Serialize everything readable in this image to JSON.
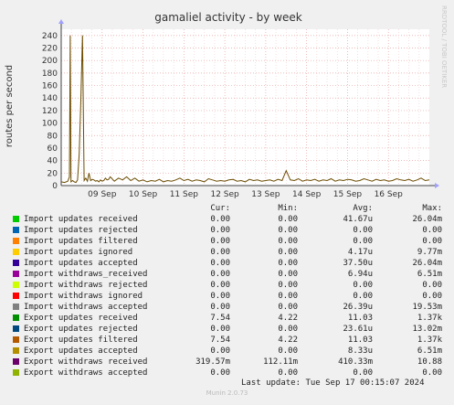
{
  "chart_data": {
    "type": "line",
    "title": "gamaliel activity - by week",
    "ylabel": "routes per second",
    "watermark": "RRDTOOL / TOBI OETIKER",
    "x_ticks": [
      "09 Sep",
      "10 Sep",
      "11 Sep",
      "12 Sep",
      "13 Sep",
      "14 Sep",
      "15 Sep",
      "16 Sep"
    ],
    "y_ticks": [
      0,
      20,
      40,
      60,
      80,
      100,
      120,
      140,
      160,
      180,
      200,
      220,
      240
    ],
    "ylim": [
      0,
      250
    ],
    "x_range_days": [
      "08 Sep 2024 (approx.)",
      "17 Sep 2024"
    ],
    "grid": true,
    "series": [
      {
        "name": "Export withdraws received",
        "color": "#6b4c00",
        "x": [
          0.0,
          0.08,
          0.16,
          0.2,
          0.22,
          0.24,
          0.28,
          0.32,
          0.36,
          0.4,
          0.44,
          0.48,
          0.52,
          0.56,
          0.6,
          0.64,
          0.68,
          0.72,
          0.76,
          0.8,
          0.84,
          0.88,
          0.92,
          0.96,
          1.0,
          1.04,
          1.08,
          1.12,
          1.16,
          1.2,
          1.3,
          1.4,
          1.5,
          1.6,
          1.7,
          1.8,
          1.9,
          2.0,
          2.1,
          2.2,
          2.3,
          2.4,
          2.5,
          2.6,
          2.7,
          2.8,
          2.9,
          3.0,
          3.1,
          3.2,
          3.3,
          3.4,
          3.5,
          3.6,
          3.7,
          3.8,
          3.9,
          4.0,
          4.1,
          4.2,
          4.3,
          4.4,
          4.5,
          4.6,
          4.7,
          4.8,
          4.9,
          5.0,
          5.1,
          5.2,
          5.3,
          5.4,
          5.5,
          5.6,
          5.7,
          5.8,
          5.9,
          6.0,
          6.1,
          6.2,
          6.3,
          6.4,
          6.5,
          6.6,
          6.7,
          6.8,
          6.9,
          7.0,
          7.1,
          7.2,
          7.3,
          7.4,
          7.5,
          7.6,
          7.7,
          7.8,
          7.9,
          8.0,
          8.1,
          8.2,
          8.3,
          8.4,
          8.5,
          8.6,
          8.7,
          8.8,
          8.9,
          9.0
        ],
        "values": [
          6,
          5,
          7,
          14,
          240,
          6,
          8,
          6,
          5,
          9,
          50,
          137,
          240,
          8,
          12,
          7,
          20,
          8,
          10,
          9,
          7,
          8,
          6,
          9,
          7,
          8,
          12,
          9,
          10,
          14,
          7,
          12,
          9,
          14,
          8,
          12,
          7,
          9,
          6,
          8,
          7,
          10,
          6,
          8,
          7,
          9,
          12,
          8,
          10,
          7,
          9,
          8,
          6,
          11,
          9,
          7,
          8,
          7,
          9,
          10,
          7,
          8,
          6,
          10,
          8,
          9,
          7,
          8,
          9,
          7,
          10,
          8,
          24,
          9,
          8,
          11,
          7,
          9,
          8,
          10,
          7,
          9,
          8,
          11,
          7,
          9,
          8,
          10,
          9,
          7,
          8,
          11,
          9,
          7,
          10,
          8,
          9,
          7,
          8,
          11,
          9,
          8,
          10,
          7,
          9,
          12,
          8,
          9
        ]
      }
    ]
  },
  "legend": {
    "headers": [
      "Cur:",
      "Min:",
      "Avg:",
      "Max:"
    ],
    "rows": [
      {
        "name": "Import updates received",
        "color": "#00cc00",
        "cur": "0.00",
        "min": "0.00",
        "avg": "41.67u",
        "max": "26.04m"
      },
      {
        "name": "Import updates rejected",
        "color": "#0066b3",
        "cur": "0.00",
        "min": "0.00",
        "avg": "0.00",
        "max": "0.00"
      },
      {
        "name": "Import updates filtered",
        "color": "#ff8000",
        "cur": "0.00",
        "min": "0.00",
        "avg": "0.00",
        "max": "0.00"
      },
      {
        "name": "Import updates ignored",
        "color": "#ffcc00",
        "cur": "0.00",
        "min": "0.00",
        "avg": "4.17u",
        "max": "9.77m"
      },
      {
        "name": "Import updates accepted",
        "color": "#330099",
        "cur": "0.00",
        "min": "0.00",
        "avg": "37.50u",
        "max": "26.04m"
      },
      {
        "name": "Import withdraws_received",
        "color": "#990099",
        "cur": "0.00",
        "min": "0.00",
        "avg": "6.94u",
        "max": "6.51m"
      },
      {
        "name": "Import withdraws rejected",
        "color": "#ccff00",
        "cur": "0.00",
        "min": "0.00",
        "avg": "0.00",
        "max": "0.00"
      },
      {
        "name": "Import withdraws ignored",
        "color": "#ff0000",
        "cur": "0.00",
        "min": "0.00",
        "avg": "0.00",
        "max": "0.00"
      },
      {
        "name": "Import withdraws accepted",
        "color": "#808080",
        "cur": "0.00",
        "min": "0.00",
        "avg": "26.39u",
        "max": "19.53m"
      },
      {
        "name": "Export updates received",
        "color": "#008f00",
        "cur": "7.54",
        "min": "4.22",
        "avg": "11.03",
        "max": "1.37k"
      },
      {
        "name": "Export updates rejected",
        "color": "#00487d",
        "cur": "0.00",
        "min": "0.00",
        "avg": "23.61u",
        "max": "13.02m"
      },
      {
        "name": "Export updates filtered",
        "color": "#b35a00",
        "cur": "7.54",
        "min": "4.22",
        "avg": "11.03",
        "max": "1.37k"
      },
      {
        "name": "Export updates accepted",
        "color": "#b38f00",
        "cur": "0.00",
        "min": "0.00",
        "avg": "8.33u",
        "max": "6.51m"
      },
      {
        "name": "Export withdraws received",
        "color": "#6b006b",
        "cur": "319.57m",
        "min": "112.11m",
        "avg": "410.33m",
        "max": "10.88"
      },
      {
        "name": "Export withdraws accepted",
        "color": "#8fb300",
        "cur": "0.00",
        "min": "0.00",
        "avg": "0.00",
        "max": "0.00"
      }
    ]
  },
  "footer": {
    "last_update": "Last update: Tue Sep 17 00:15:07 2024",
    "munin": "Munin 2.0.73"
  }
}
